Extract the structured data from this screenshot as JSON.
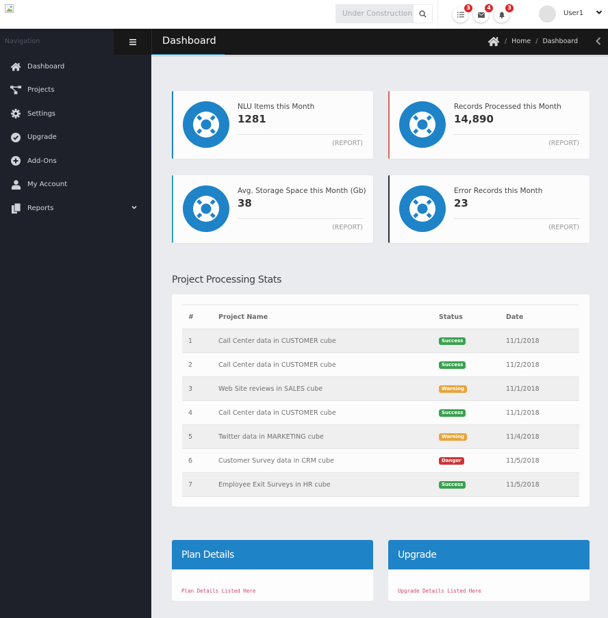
{
  "header": {
    "logo_alt": "broken-image",
    "search": {
      "placeholder": "Under Construction",
      "value": ""
    },
    "notifications": [
      {
        "name": "tasks",
        "icon": "list-icon",
        "count": "3"
      },
      {
        "name": "messages",
        "icon": "envelope-icon",
        "count": "4"
      },
      {
        "name": "alerts",
        "icon": "bell-icon",
        "count": "3"
      }
    ],
    "user": {
      "name": "User1"
    }
  },
  "sidebar": {
    "heading": "Navigation",
    "items": [
      {
        "label": "Dashboard",
        "icon": "home-icon"
      },
      {
        "label": "Projects",
        "icon": "sitemap-icon"
      },
      {
        "label": "Settings",
        "icon": "gear-icon"
      },
      {
        "label": "Upgrade",
        "icon": "check-circle-icon"
      },
      {
        "label": "Add-Ons",
        "icon": "plus-circle-icon"
      },
      {
        "label": "My Account",
        "icon": "user-icon"
      },
      {
        "label": "Reports",
        "icon": "files-icon",
        "has_submenu": true
      }
    ]
  },
  "titlebar": {
    "title": "Dashboard",
    "breadcrumb": [
      "Home",
      "Dashboard"
    ],
    "separator": "/"
  },
  "stats": [
    {
      "label": "NLU Items this Month",
      "value": "1281",
      "link": "(REPORT)",
      "accent": "#1f83c8"
    },
    {
      "label": "Records Processed this Month",
      "value": "14,890",
      "link": "(REPORT)",
      "accent": "#d9655f"
    },
    {
      "label": "Avg. Storage Space this Month (Gb)",
      "value": "38",
      "link": "(REPORT)",
      "accent": "#2aa5c0"
    },
    {
      "label": "Error Records this Month",
      "value": "23",
      "link": "(REPORT)",
      "accent": "#2b2f36"
    }
  ],
  "projects": {
    "title": "Project Processing Stats",
    "columns": [
      "#",
      "Project Name",
      "Status",
      "Date"
    ],
    "rows": [
      {
        "num": "1",
        "name": "Call Center data in CUSTOMER cube",
        "status": "Success",
        "date": "11/1/2018"
      },
      {
        "num": "2",
        "name": "Call Center data in CUSTOMER cube",
        "status": "Success",
        "date": "11/2/2018"
      },
      {
        "num": "3",
        "name": "Web Site reviews in SALES cube",
        "status": "Warning",
        "date": "11/1/2018"
      },
      {
        "num": "4",
        "name": "Call Center data in CUSTOMER cube",
        "status": "Success",
        "date": "11/1/2018"
      },
      {
        "num": "5",
        "name": "Twitter data in MARKETING cube",
        "status": "Warning",
        "date": "11/4/2018"
      },
      {
        "num": "6",
        "name": "Customer Survey data in CRM cube",
        "status": "Danger",
        "date": "11/5/2018"
      },
      {
        "num": "7",
        "name": "Employee Exit Surveys in HR cube",
        "status": "Success",
        "date": "11/5/2018"
      }
    ],
    "status_colors": {
      "Success": "#3aa04f",
      "Warning": "#eaa43a",
      "Danger": "#cc3535"
    }
  },
  "panels": [
    {
      "title": "Plan Details",
      "body": "Plan Details Listed Here"
    },
    {
      "title": "Upgrade",
      "body": "Upgrade Details Listed Here"
    }
  ],
  "colors": {
    "brand": "#1f83c8",
    "sidebar": "#1e2129",
    "titlebar": "#181818",
    "background": "#eaebef"
  }
}
